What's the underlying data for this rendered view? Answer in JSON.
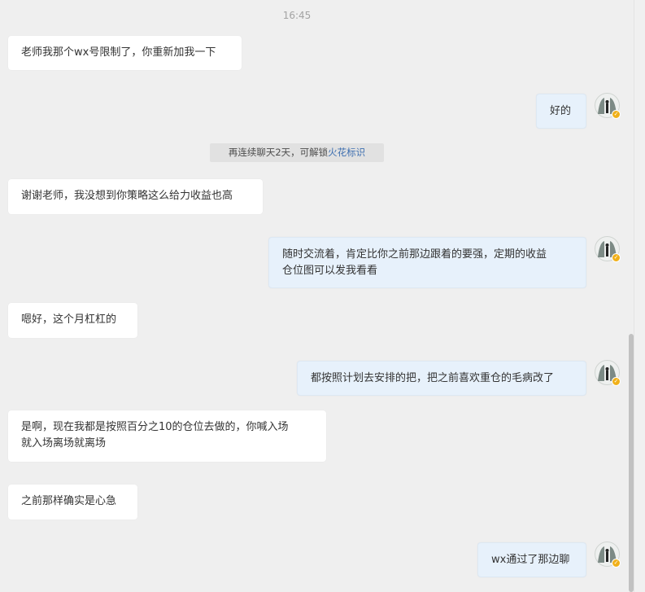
{
  "timestamp": "16:45",
  "notice": {
    "text": "再连续聊天2天，可解锁",
    "link": "火花标识"
  },
  "messages": [
    {
      "side": "left",
      "text": "老师我那个wx号限制了，你重新加我一下"
    },
    {
      "side": "right",
      "text": "好的"
    },
    {
      "side": "left",
      "text": "谢谢老师，我没想到你策略这么给力收益也高"
    },
    {
      "side": "right",
      "line1": "随时交流着，肯定比你之前那边跟着的要强，定期的收益",
      "line2": "仓位图可以发我看看"
    },
    {
      "side": "left",
      "text": "嗯好，这个月杠杠的"
    },
    {
      "side": "right",
      "text": "都按照计划去安排的把，把之前喜欢重仓的毛病改了"
    },
    {
      "side": "left",
      "line1": "是啊，现在我都是按照百分之10的仓位去做的，你喊入场",
      "line2": "就入场离场就离场"
    },
    {
      "side": "left",
      "text": "之前那样确实是心急"
    },
    {
      "side": "right",
      "text": "wx通过了那边聊"
    }
  ],
  "colors": {
    "background": "#efefef",
    "left_bubble": "#ffffff",
    "right_bubble": "#e7f1fb",
    "link": "#3e6fb0",
    "badge": "#f0b019"
  },
  "icons": [
    "user-avatar",
    "verified-badge-icon"
  ]
}
